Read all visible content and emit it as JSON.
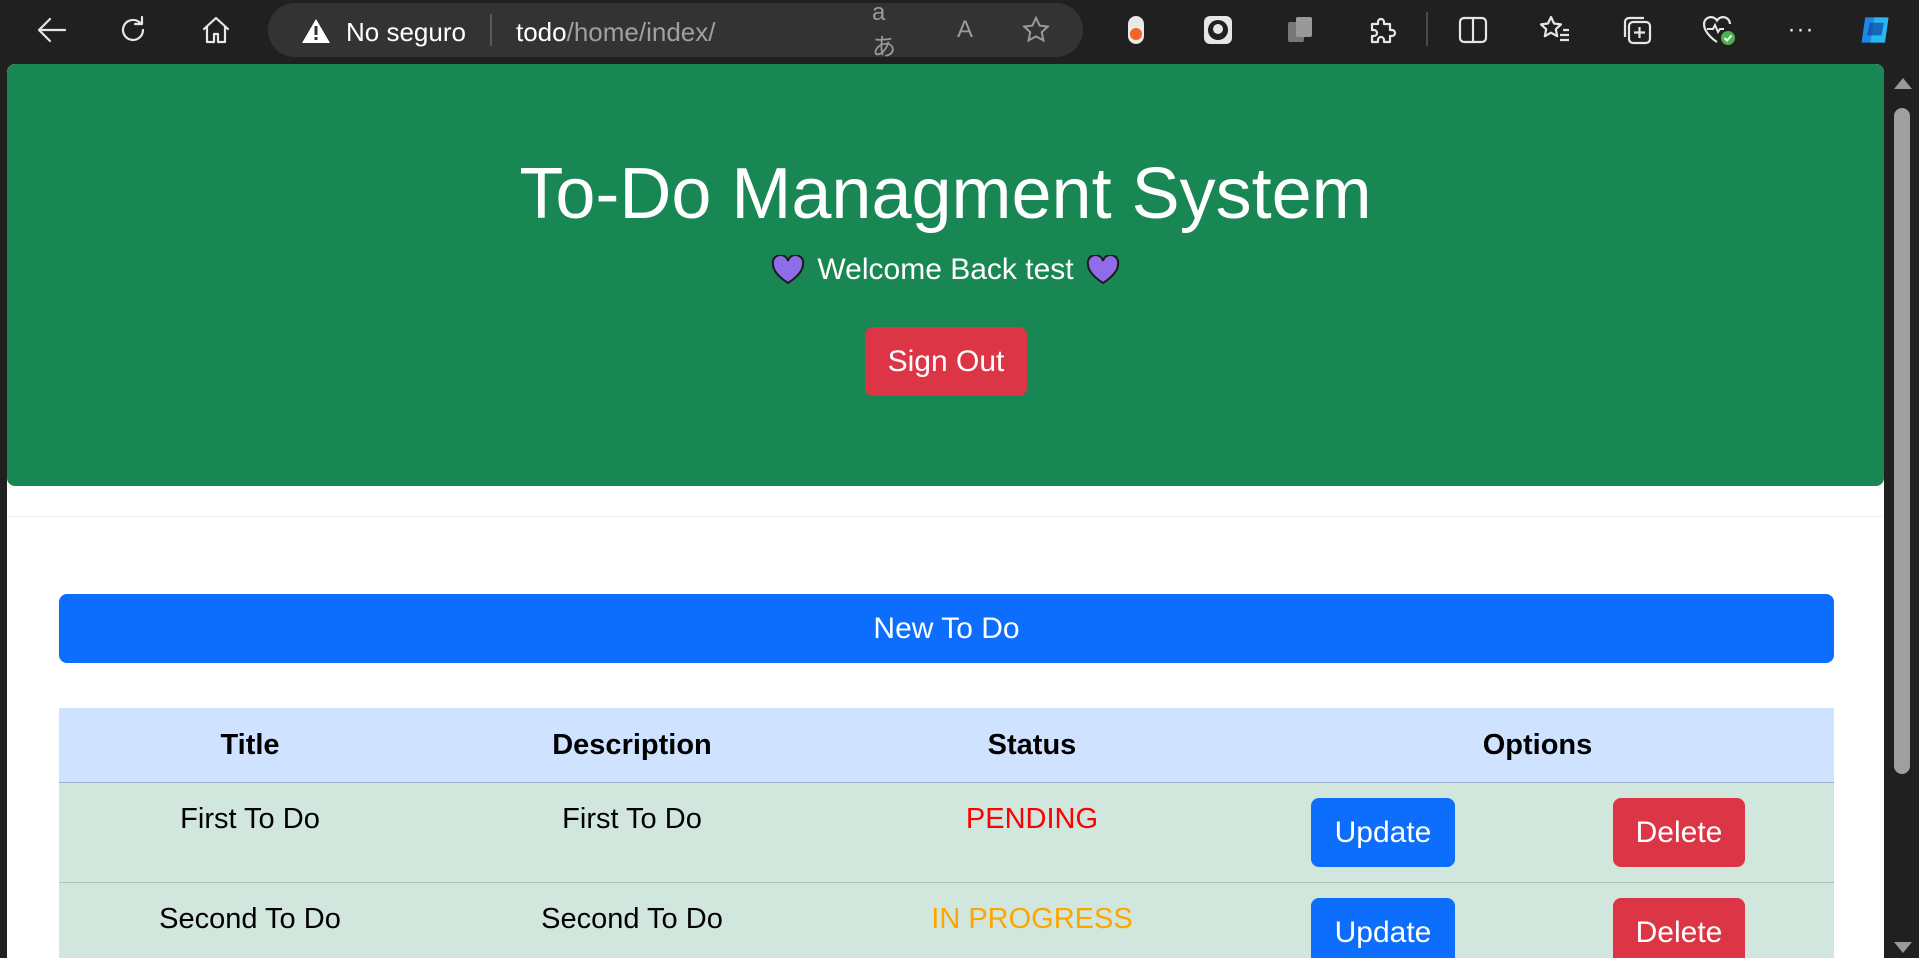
{
  "browser": {
    "security_label": "No seguro",
    "url_host": "todo",
    "url_path": "/home/index/",
    "translate_glyph": "aあ",
    "read_aloud_glyph": "A",
    "more_glyph": "···"
  },
  "hero": {
    "title": "To-Do Managment System",
    "welcome": "Welcome Back test",
    "heart_color": "#8f6ce8",
    "signout_label": "Sign Out"
  },
  "actions": {
    "new_todo_label": "New To Do"
  },
  "table": {
    "headers": {
      "title": "Title",
      "description": "Description",
      "status": "Status",
      "options": "Options"
    },
    "rows": [
      {
        "title": "First To Do",
        "description": "First To Do",
        "status": "PENDING",
        "status_color": "#ff0000",
        "update_label": "Update",
        "delete_label": "Delete"
      },
      {
        "title": "Second To Do",
        "description": "Second To Do",
        "status": "IN PROGRESS",
        "status_color": "#ffa500",
        "update_label": "Update",
        "delete_label": "Delete"
      }
    ]
  },
  "colors": {
    "hero_bg": "#198754",
    "primary": "#0d6efd",
    "danger": "#dc3545",
    "thead_bg": "#cfe2ff",
    "row_bg": "#d1e7dd"
  }
}
